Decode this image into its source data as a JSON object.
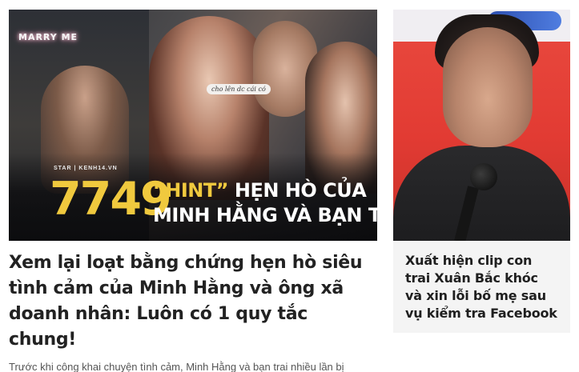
{
  "main_story": {
    "thumbnail": {
      "neon_sign": "MARRY ME",
      "chat_bubble": "cho lên dc cái có",
      "brand": "STAR  |  KENH14.VN",
      "big_number": "7749",
      "headline_hint": "“HINT”",
      "headline_rest": " HẸN HÒ CỦA",
      "headline_line2": "MINH HẰNG VÀ BẠN TRAI",
      "accent_color": "#f0c93e"
    },
    "title": "Xem lại loạt bằng chứng hẹn hò siêu tình cảm của Minh Hằng và ông xã doanh nhân: Luôn có 1 quy tắc chung!",
    "sapo": "Trước khi công khai chuyện tình cảm, Minh Hằng và bạn trai nhiều lần bị netizen soi \"hint\" hẹn hò."
  },
  "side_story": {
    "title": "Xuất hiện clip con trai Xuân Bắc khóc và xin lỗi bố mẹ sau vụ kiểm tra Facebook",
    "background_color": "#f4f4f4"
  }
}
